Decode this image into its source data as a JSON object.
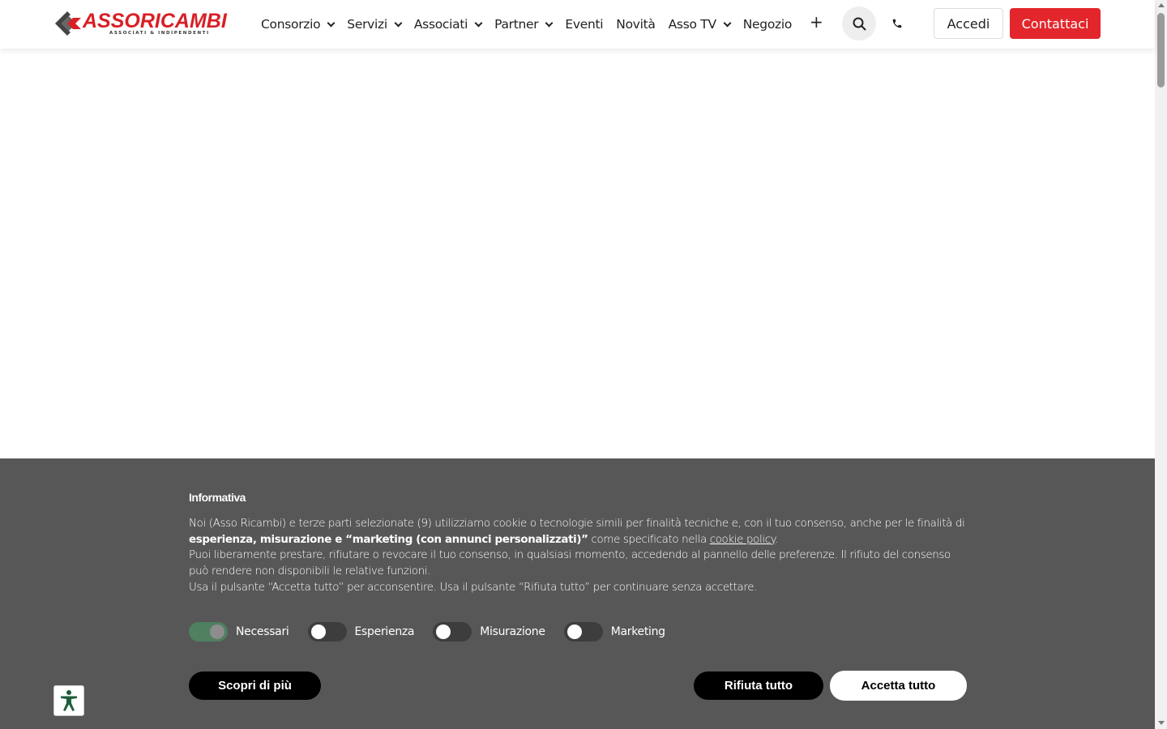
{
  "header": {
    "logo_text": "ASSORICAMBI",
    "logo_subtitle": "ASSOCIATI & INDIPENDENTI",
    "nav": [
      {
        "label": "Consorzio",
        "has_dropdown": true
      },
      {
        "label": "Servizi",
        "has_dropdown": true
      },
      {
        "label": "Associati",
        "has_dropdown": true
      },
      {
        "label": "Partner",
        "has_dropdown": true
      },
      {
        "label": "Eventi",
        "has_dropdown": false
      },
      {
        "label": "Novità",
        "has_dropdown": false
      },
      {
        "label": "Asso TV",
        "has_dropdown": true
      },
      {
        "label": "Negozio",
        "has_dropdown": false
      }
    ],
    "more_label": "+",
    "search_icon": "search-icon",
    "phone_icon": "phone-icon",
    "login_label": "Accedi",
    "contact_label": "Contattaci"
  },
  "colors": {
    "brand_red": "#e3262b",
    "banner_bg": "#575757",
    "toggle_on": "#4f8060"
  },
  "cookie": {
    "title": "Informativa",
    "line1_a": "Noi (Asso Ricambi) e terze parti selezionate (9) utilizziamo cookie o tecnologie simili per finalità tecniche e, con il tuo consenso, anche per le finalità di ",
    "line1_bold": "esperienza, misurazione e “marketing (con annunci personalizzati)”",
    "line1_b": " come specificato nella ",
    "link": "cookie policy",
    "line1_end": ".",
    "line2": "Puoi liberamente prestare, rifiutare o revocare il tuo consenso, in qualsiasi momento, accedendo al pannello delle preferenze. Il rifiuto del consenso può rendere non disponibili le relative funzioni.",
    "line3": "Usa il pulsante “Accetta tutto” per acconsentire. Usa il pulsante “Rifiuta tutto” per continuare senza accettare.",
    "toggles": [
      {
        "label": "Necessari",
        "on": true
      },
      {
        "label": "Esperienza",
        "on": false
      },
      {
        "label": "Misurazione",
        "on": false
      },
      {
        "label": "Marketing",
        "on": false
      }
    ],
    "more_label": "Scopri di più",
    "reject_label": "Rifiuta tutto",
    "accept_label": "Accetta tutto"
  },
  "accessibility": {
    "icon": "accessibility-icon"
  }
}
